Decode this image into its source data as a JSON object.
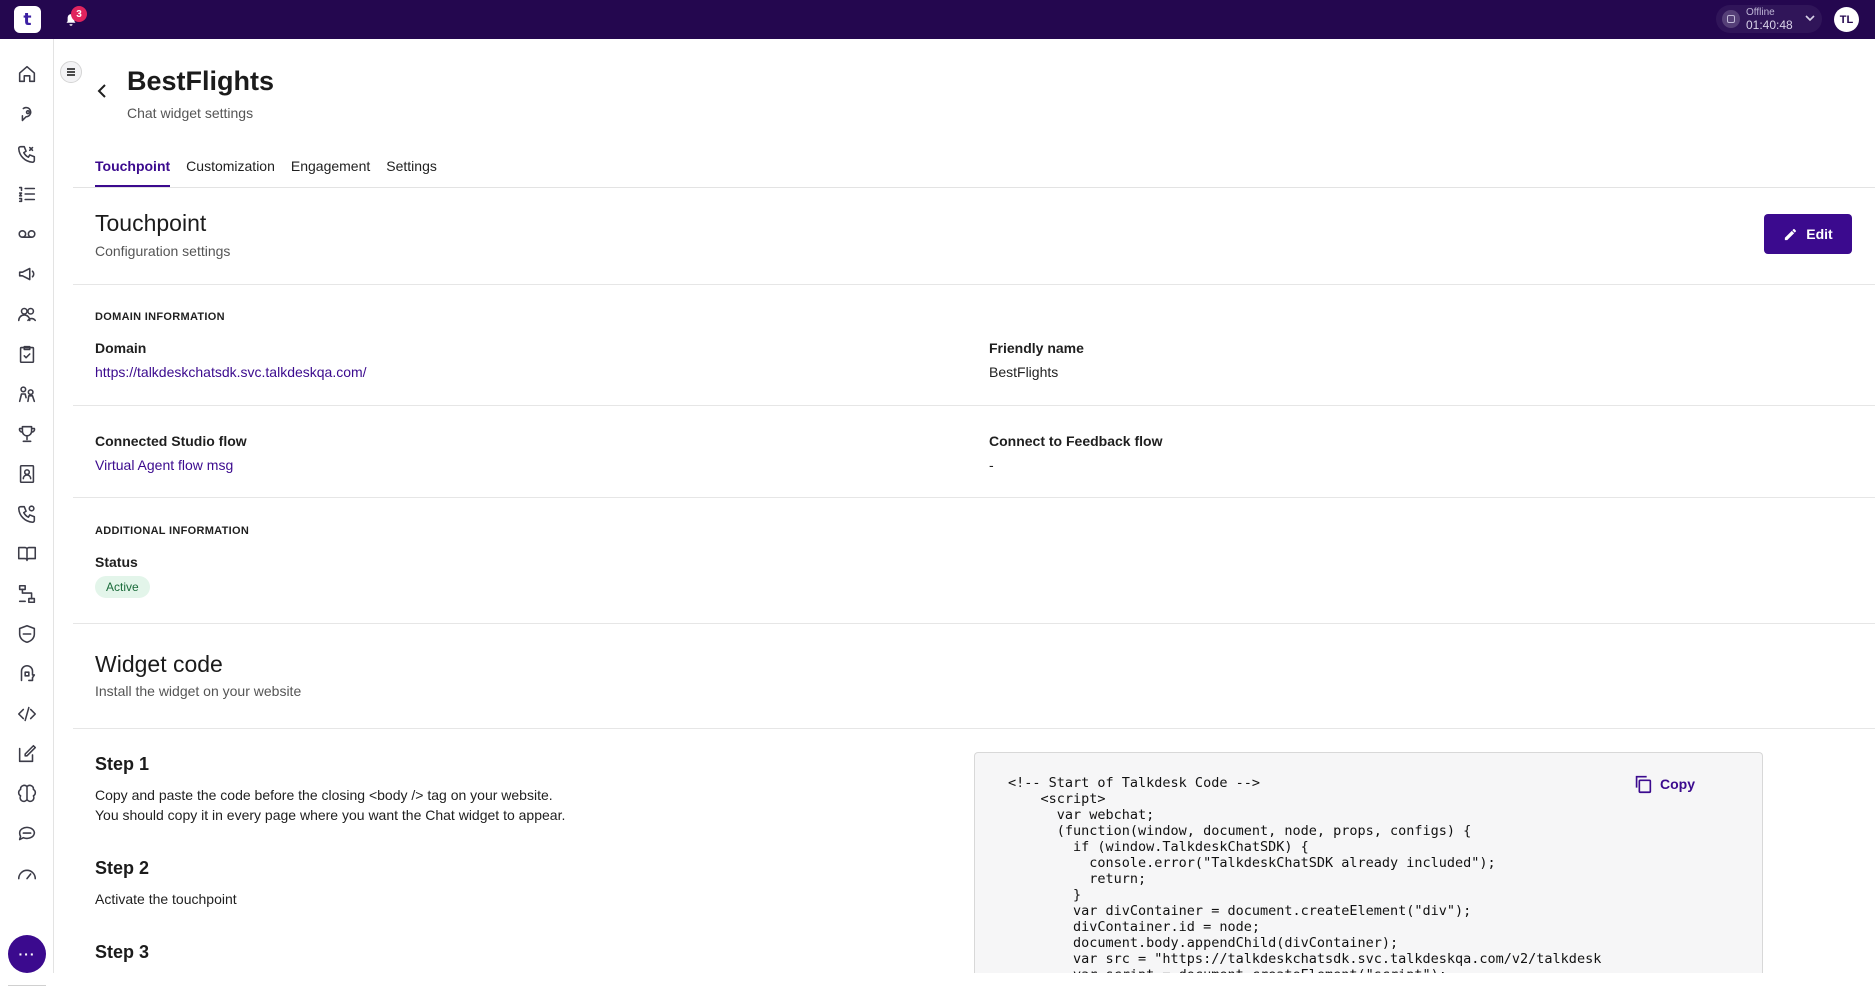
{
  "topbar": {
    "logo_text": "t",
    "notification_count": "3",
    "status": {
      "label": "Offline",
      "timer": "01:40:48"
    },
    "user_initials": "TL"
  },
  "sidebar": {
    "items": [
      {
        "icon": "home-icon"
      },
      {
        "icon": "conversations-icon"
      },
      {
        "icon": "calls-icon"
      },
      {
        "icon": "lists-icon"
      },
      {
        "icon": "voicemail-icon"
      },
      {
        "icon": "campaigns-icon"
      },
      {
        "icon": "team-icon"
      },
      {
        "icon": "tasks-icon"
      },
      {
        "icon": "people-icon"
      },
      {
        "icon": "trophy-icon"
      },
      {
        "icon": "contacts-icon"
      },
      {
        "icon": "phone-settings-icon"
      },
      {
        "icon": "knowledge-icon"
      },
      {
        "icon": "flow-icon"
      },
      {
        "icon": "shield-icon"
      },
      {
        "icon": "ai-icon"
      },
      {
        "icon": "code-icon"
      },
      {
        "icon": "edit-icon"
      },
      {
        "icon": "brain-icon"
      },
      {
        "icon": "chat-icon"
      },
      {
        "icon": "dashboard-icon"
      }
    ],
    "more_label": "···"
  },
  "header": {
    "title": "BestFlights",
    "subtitle": "Chat widget settings"
  },
  "tabs": [
    {
      "label": "Touchpoint",
      "active": true
    },
    {
      "label": "Customization",
      "active": false
    },
    {
      "label": "Engagement",
      "active": false
    },
    {
      "label": "Settings",
      "active": false
    }
  ],
  "touchpoint": {
    "title": "Touchpoint",
    "subtitle": "Configuration settings",
    "edit_label": "Edit",
    "domain_information": {
      "heading": "DOMAIN INFORMATION",
      "domain_label": "Domain",
      "domain_value": "https://talkdeskchatsdk.svc.talkdeskqa.com/",
      "friendly_name_label": "Friendly name",
      "friendly_name_value": "BestFlights"
    },
    "flows": {
      "studio_label": "Connected Studio flow",
      "studio_value": "Virtual Agent flow msg",
      "feedback_label": "Connect to Feedback flow",
      "feedback_value": "-"
    },
    "additional_information": {
      "heading": "ADDITIONAL INFORMATION",
      "status_label": "Status",
      "status_value": "Active"
    }
  },
  "widget_code": {
    "title": "Widget code",
    "subtitle": "Install the widget on your website",
    "steps": [
      {
        "title": "Step 1",
        "lines": [
          "Copy and paste the code before the closing <body /> tag on your website.",
          "You should copy it in every page where you want the Chat widget to appear."
        ]
      },
      {
        "title": "Step 2",
        "lines": [
          "Activate the touchpoint"
        ]
      },
      {
        "title": "Step 3",
        "lines": []
      }
    ],
    "copy_label": "Copy",
    "code": "<!-- Start of Talkdesk Code -->\n    <script>\n      var webchat;\n      (function(window, document, node, props, configs) {\n        if (window.TalkdeskChatSDK) {\n          console.error(\"TalkdeskChatSDK already included\");\n          return;\n        }\n        var divContainer = document.createElement(\"div\");\n        divContainer.id = node;\n        document.body.appendChild(divContainer);\n        var src = \"https://talkdeskchatsdk.svc.talkdeskqa.com/v2/talkdesk\n        var script = document.createElement(\"script\");"
  },
  "colors": {
    "topbar": "#24074f",
    "accent": "#3b0a8e",
    "status_active_bg": "#e3f5ea",
    "status_active_text": "#1a6b3a"
  }
}
